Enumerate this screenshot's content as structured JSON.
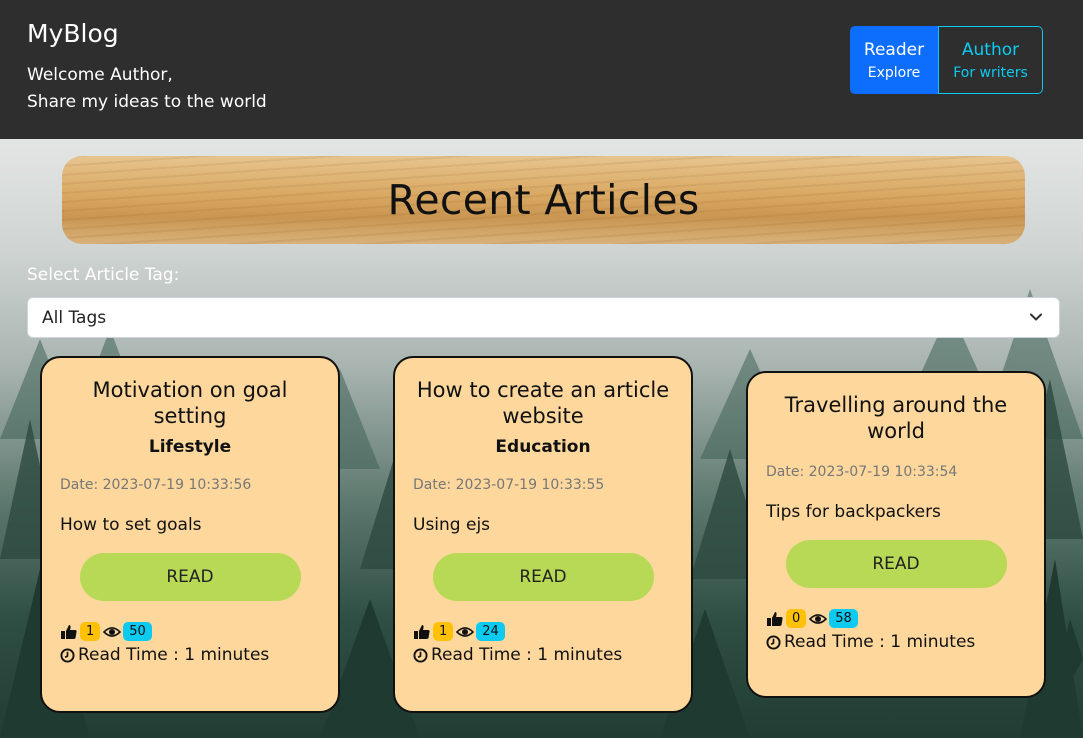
{
  "header": {
    "brand": "MyBlog",
    "welcome_line1": "Welcome Author,",
    "welcome_line2": "Share my ideas to the world",
    "modes": [
      {
        "label": "Reader",
        "sub": "Explore"
      },
      {
        "label": "Author",
        "sub": "For writers"
      }
    ]
  },
  "banner": {
    "title": "Recent Articles"
  },
  "filter": {
    "label": "Select Article Tag:",
    "selected": "All Tags"
  },
  "articles": [
    {
      "title": "Motivation on goal setting",
      "tag": "Lifestyle",
      "date": "Date: 2023-07-19 10:33:56",
      "description": "How to set goals",
      "read_label": "READ",
      "likes": "1",
      "views": "50",
      "read_time": "Read Time : 1 minutes"
    },
    {
      "title": "How to create an article website",
      "tag": "Education",
      "date": "Date: 2023-07-19 10:33:55",
      "description": "Using ejs",
      "read_label": "READ",
      "likes": "1",
      "views": "24",
      "read_time": "Read Time : 1 minutes"
    },
    {
      "title": "Travelling around the world",
      "tag": "",
      "date": "Date: 2023-07-19 10:33:54",
      "description": "Tips for backpackers",
      "read_label": "READ",
      "likes": "0",
      "views": "58",
      "read_time": "Read Time : 1 minutes"
    }
  ],
  "colors": {
    "header_bg": "#2e2e2e",
    "reader_btn": "#0d6efd",
    "author_btn": "#0dcaf0",
    "card_bg": "#fdd79c",
    "read_btn": "#b8d955",
    "like_badge": "#ffc107",
    "view_badge": "#0dcaf0"
  },
  "icons": [
    "thumbs-up-icon",
    "eye-icon",
    "clock-icon",
    "chevron-down-icon"
  ]
}
